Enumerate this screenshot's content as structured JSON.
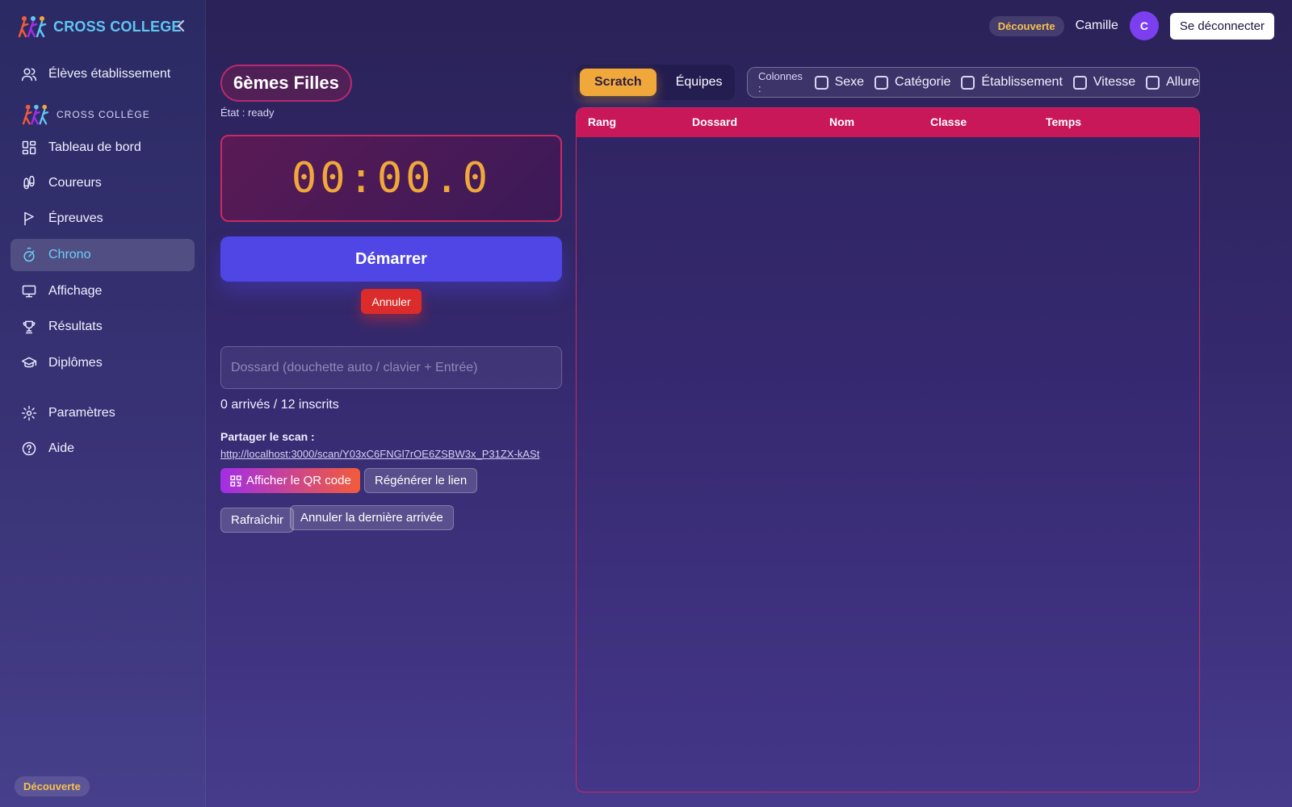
{
  "sidebar": {
    "brand": "CROSS COLLEGE",
    "items_top": [
      {
        "label": "Élèves établissement",
        "icon": "users-icon"
      }
    ],
    "section_label": "CROSS COLLÈGE",
    "items": [
      {
        "label": "Tableau de bord",
        "icon": "dashboard-icon"
      },
      {
        "label": "Coureurs",
        "icon": "footprints-icon"
      },
      {
        "label": "Épreuves",
        "icon": "flag-icon"
      },
      {
        "label": "Chrono",
        "icon": "stopwatch-icon",
        "active": true
      },
      {
        "label": "Affichage",
        "icon": "monitor-icon"
      },
      {
        "label": "Résultats",
        "icon": "trophy-icon"
      },
      {
        "label": "Diplômes",
        "icon": "graduation-cap-icon"
      }
    ],
    "items_bottom": [
      {
        "label": "Paramètres",
        "icon": "gear-icon"
      },
      {
        "label": "Aide",
        "icon": "help-icon"
      }
    ],
    "plan_badge": "Découverte"
  },
  "topbar": {
    "plan_badge": "Découverte",
    "user_name": "Camille",
    "avatar_initial": "C",
    "logout_label": "Se déconnecter"
  },
  "race": {
    "title": "6èmes Filles",
    "state": "État : ready",
    "timer": "00:00.0",
    "start_label": "Démarrer",
    "cancel_label": "Annuler",
    "bib_placeholder": "Dossard (douchette auto / clavier + Entrée)",
    "arrivals": "0 arrivés / 12 inscrits",
    "share_label": "Partager le scan :",
    "share_url": "http://localhost:3000/scan/Y03xC6FNGl7rOE6ZSBW3x_P31ZX-kASt",
    "qr_label": "Afficher le QR code",
    "regenerate_label": "Régénérer le lien",
    "refresh_label": "Rafraîchir",
    "undo_last_label": "Annuler la dernière arrivée"
  },
  "results": {
    "tabs": [
      {
        "label": "Scratch",
        "active": true
      },
      {
        "label": "Équipes",
        "active": false
      }
    ],
    "columns_label": "Colonnes :",
    "column_options": [
      "Sexe",
      "Catégorie",
      "Établissement",
      "Vitesse",
      "Allure"
    ],
    "headers": [
      "Rang",
      "Dossard",
      "Nom",
      "Classe",
      "Temps"
    ],
    "rows": []
  },
  "colors": {
    "accent": "#4f46e5",
    "brand": "#5fc6f2",
    "timer": "#f1a83a",
    "table_header": "#c8185a",
    "danger": "#dc2b2b"
  }
}
